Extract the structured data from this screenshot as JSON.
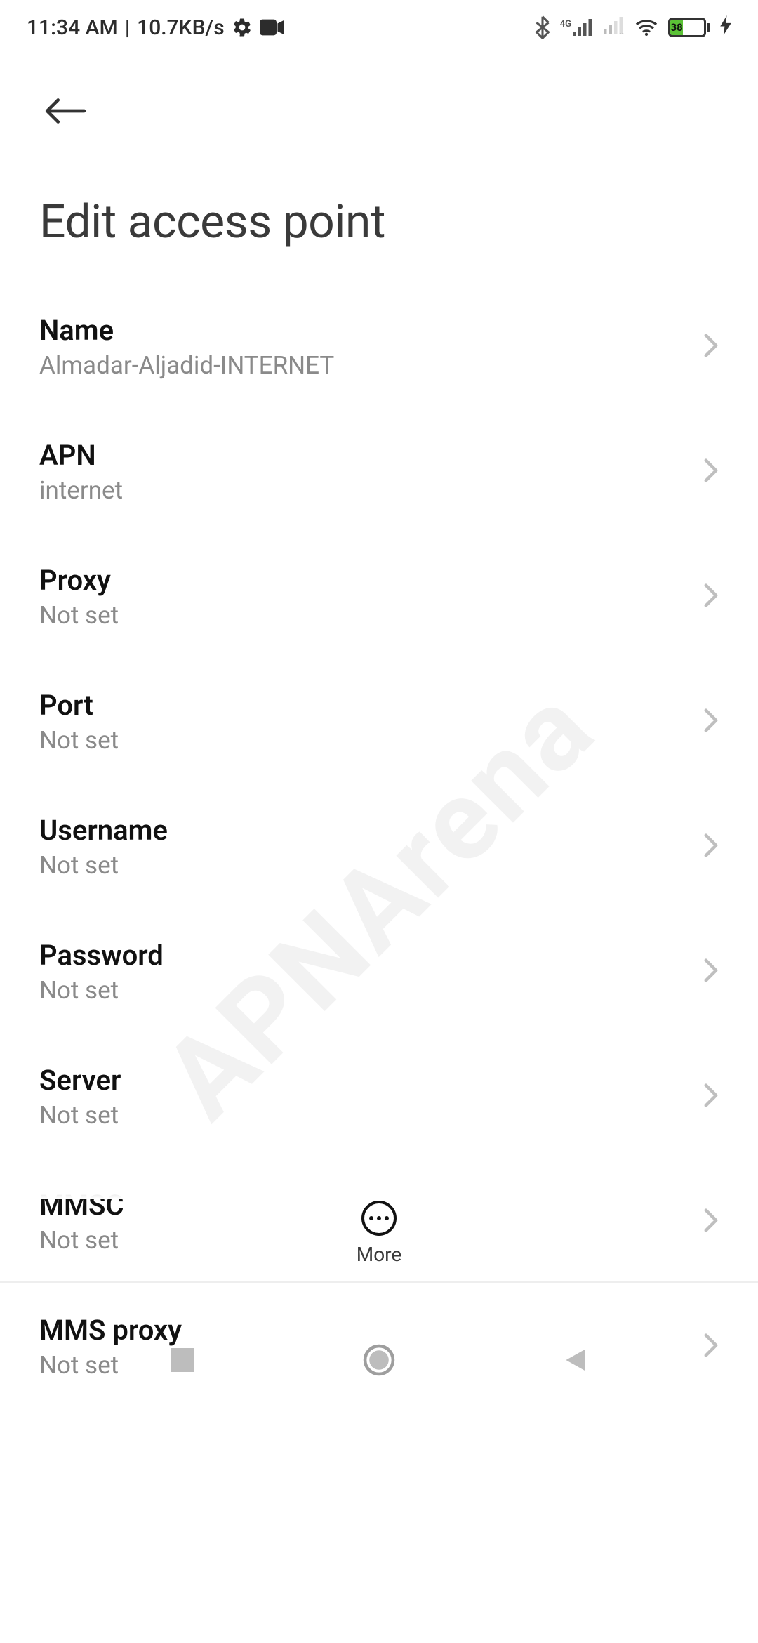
{
  "status_bar": {
    "time": "11:34 AM",
    "net_speed": "10.7KB/s",
    "battery_percent": "38",
    "network_label": "4G"
  },
  "page": {
    "title": "Edit access point"
  },
  "items": [
    {
      "label": "Name",
      "value": "Almadar-Aljadid-INTERNET"
    },
    {
      "label": "APN",
      "value": "internet"
    },
    {
      "label": "Proxy",
      "value": "Not set"
    },
    {
      "label": "Port",
      "value": "Not set"
    },
    {
      "label": "Username",
      "value": "Not set"
    },
    {
      "label": "Password",
      "value": "Not set"
    },
    {
      "label": "Server",
      "value": "Not set"
    },
    {
      "label": "MMSC",
      "value": "Not set"
    },
    {
      "label": "MMS proxy",
      "value": "Not set"
    }
  ],
  "more": {
    "label": "More"
  },
  "watermark": "APNArena"
}
